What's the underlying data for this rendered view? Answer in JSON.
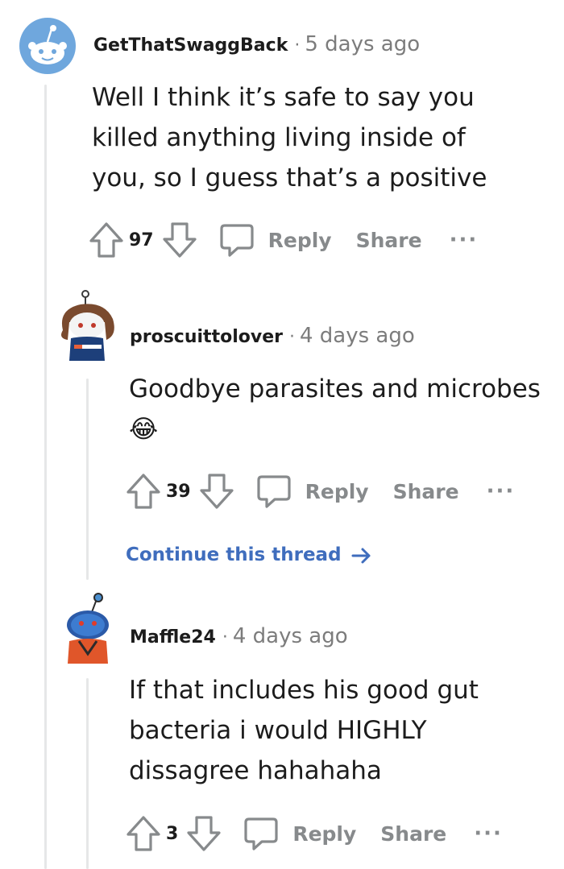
{
  "comments": [
    {
      "author": "GetThatSwaggBack",
      "time": "5 days ago",
      "separator": "·",
      "body": [
        "Well I think it’s safe to say you",
        "killed anything living inside of",
        "you, so I guess that’s a positive"
      ],
      "score": "97",
      "reply_label": "Reply",
      "share_label": "Share",
      "more_label": "···"
    },
    {
      "author": "proscuittolover",
      "time": "4 days ago",
      "separator": "·",
      "body": [
        "Goodbye parasites and microbes"
      ],
      "emoji": "😂",
      "score": "39",
      "reply_label": "Reply",
      "share_label": "Share",
      "more_label": "···",
      "continue_label": "Continue this thread"
    },
    {
      "author": "Maffle24",
      "time": "4 days ago",
      "separator": "·",
      "body": [
        "If that includes his good gut",
        "bacteria i would HIGHLY",
        "dissagree hahahaha"
      ],
      "score": "3",
      "reply_label": "Reply",
      "share_label": "Share",
      "more_label": "···"
    }
  ],
  "colors": {
    "text": "#1c1c1c",
    "meta": "#7c7c7c",
    "action": "#878a8c",
    "link": "#3f6dbd",
    "thread_line": "#e6e7e8",
    "snoo_blue": "#6fa7dd"
  }
}
